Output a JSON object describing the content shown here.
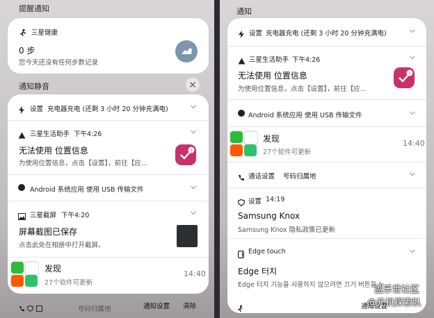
{
  "left": {
    "reminder_header": "提醒通知",
    "health": {
      "app": "三星健康",
      "title": "0 步",
      "sub": "您今天还没有任何步数记录"
    },
    "silent_header": "通知静音",
    "charging": {
      "app": "设置",
      "text": "充电器充电 (还剩 3 小时 20 分钟充满电)"
    },
    "assistant": {
      "app": "三星生活助手",
      "time": "下午4:26",
      "title": "无法使用 位置信息",
      "sub": "为使用位置信息，点击【设置】，前往【应..."
    },
    "android": {
      "app": "Android 系统应用",
      "text": "使用 USB 传输文件"
    },
    "screenshot": {
      "app": "三星截屏",
      "time": "下午4:20",
      "title": "屏幕截图已保存",
      "sub": "点击此处在相册中打开截屏。"
    },
    "discover": {
      "title": "发现",
      "sub": "27个软件可更新",
      "time": "14:40"
    },
    "footer": {
      "partial": "号码归属地",
      "settings": "通知设置",
      "clear": "清除"
    }
  },
  "right": {
    "header": "通知",
    "charging": {
      "app": "设置",
      "text": "充电器充电 (还剩 3 小时 20 分钟充满电)"
    },
    "assistant": {
      "app": "三星生活助手",
      "time": "下午4:26",
      "title": "无法使用 位置信息",
      "sub": "为使用位置信息，点击【设置】，前往【应..."
    },
    "android": {
      "app": "Android 系统应用",
      "text": "使用 USB 传输文件"
    },
    "discover": {
      "title": "发现",
      "sub": "27个软件可更新",
      "time": "14:40"
    },
    "call": {
      "app": "通话设置",
      "text": "号码归属地"
    },
    "knox": {
      "app": "设置",
      "time": "14:19",
      "title": "Samsung Knox",
      "sub": "Samsung Knox 隐私政策已更新"
    },
    "edge": {
      "app": "Edge touch",
      "title": "Edge 터치",
      "sub": "Edge 터치 기능을 사용하지 않으려면 끄기 버튼을 누..."
    },
    "footer": {
      "settings": "通知设置"
    }
  },
  "watermark": {
    "line1": "盖乐世社区",
    "line2": "@元机探索队"
  },
  "colors": {
    "badge": "#c8326a",
    "health_btn": "#7d95ad",
    "wechat": "#2dbb3a",
    "taobao": "#ff5a00"
  }
}
